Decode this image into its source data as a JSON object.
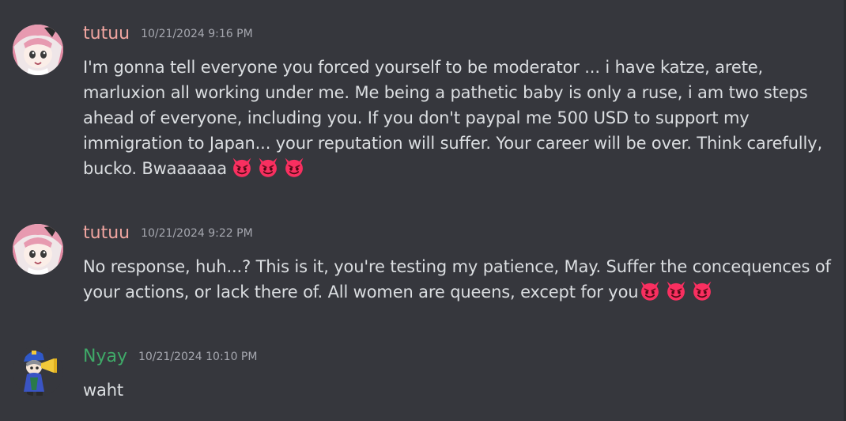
{
  "messages": [
    {
      "author": "tutuu",
      "author_color": "#f0a5a0",
      "timestamp": "10/21/2024 9:16 PM",
      "text": "I'm gonna tell everyone you forced yourself to be moderator ... i have katze, arete, marluxion all working under me. Me being a pathetic baby is only a ruse, i am two steps ahead of everyone, including you. If you don't paypal me 500 USD to support my immigration to Japan... your reputation will suffer. Your career will be over. Think carefully, bucko. Bwaaaaaa",
      "emojis": [
        "smiling-imp-emoji",
        "smiling-imp-emoji",
        "smiling-imp-emoji"
      ]
    },
    {
      "author": "tutuu",
      "author_color": "#f0a5a0",
      "timestamp": "10/21/2024 9:22 PM",
      "text": "No response, huh...? This is it, you're testing my patience, May. Suffer the concequences of your actions, or lack there of. All women are queens, except for you",
      "emojis": [
        "smiling-imp-emoji",
        "smiling-imp-emoji",
        "smiling-imp-emoji"
      ]
    },
    {
      "author": "Nyay",
      "author_color": "#3fa968",
      "timestamp": "10/21/2024 10:10 PM",
      "text": "waht",
      "emojis": []
    }
  ],
  "colors": {
    "background": "#36373d",
    "text": "#dbdee1",
    "timestamp": "#a6a8b0",
    "emoji_face": "#f92f60"
  }
}
